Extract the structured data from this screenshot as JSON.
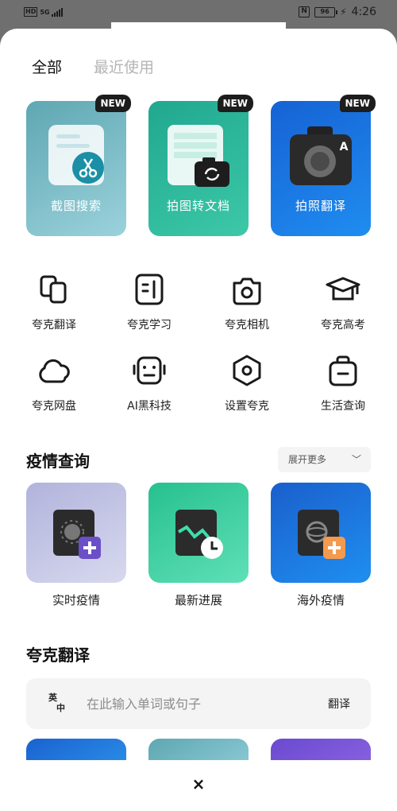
{
  "status_bar": {
    "hd": "HD",
    "network": "5G",
    "battery": "96",
    "time": "4:26"
  },
  "tabs": [
    {
      "label": "全部",
      "active": true
    },
    {
      "label": "最近使用",
      "active": false
    }
  ],
  "feature_cards": [
    {
      "label": "截图搜索",
      "badge": "NEW",
      "icon": "screenshot-scissors-icon"
    },
    {
      "label": "拍图转文档",
      "badge": "NEW",
      "icon": "photo-to-document-icon"
    },
    {
      "label": "拍照翻译",
      "badge": "NEW",
      "icon": "camera-translate-icon"
    }
  ],
  "tools": [
    {
      "label": "夸克翻译",
      "icon": "translate-icon"
    },
    {
      "label": "夸克学习",
      "icon": "study-icon"
    },
    {
      "label": "夸克相机",
      "icon": "camera-icon"
    },
    {
      "label": "夸克高考",
      "icon": "graduation-cap-icon"
    },
    {
      "label": "夸克网盘",
      "icon": "cloud-icon"
    },
    {
      "label": "AI黑科技",
      "icon": "robot-icon"
    },
    {
      "label": "设置夸克",
      "icon": "settings-hexagon-icon"
    },
    {
      "label": "生活查询",
      "icon": "bag-icon"
    }
  ],
  "covid_section": {
    "title": "疫情查询",
    "expand_label": "展开更多",
    "cards": [
      {
        "label": "实时疫情",
        "icon": "virus-plus-icon"
      },
      {
        "label": "最新进展",
        "icon": "trend-clock-icon"
      },
      {
        "label": "海外疫情",
        "icon": "globe-plus-icon"
      }
    ]
  },
  "translate_section": {
    "title": "夸克翻译",
    "lang_icon_top": "英",
    "lang_icon_bottom": "中",
    "placeholder": "在此输入单词或句子",
    "button": "翻译"
  },
  "close_symbol": "×",
  "colors": {
    "accent_teal": "#20a88f",
    "accent_blue": "#1662d4",
    "badge_dark": "#1d1d1d"
  }
}
